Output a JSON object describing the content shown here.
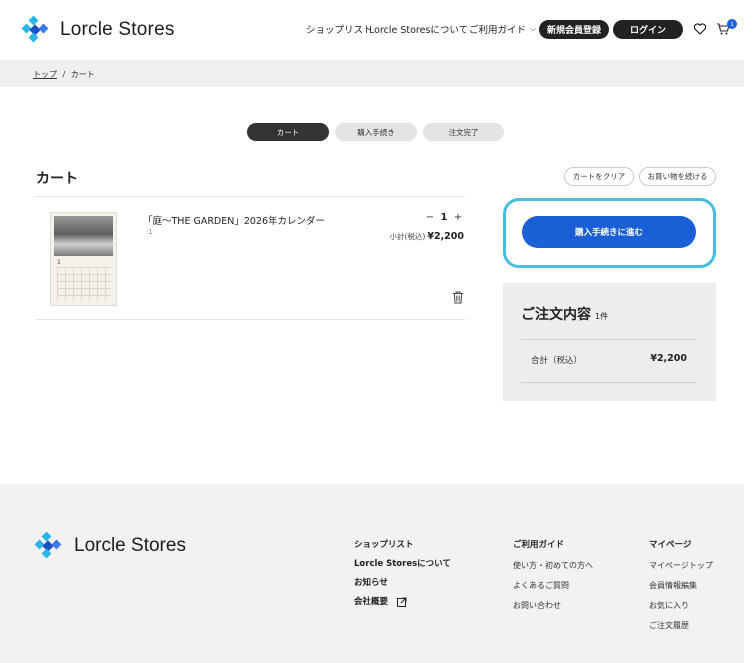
{
  "header": {
    "brand": "Lorcle Stores",
    "nav": [
      "ショップリスト",
      "Lorcle Storesについて",
      "ご利用ガイド"
    ],
    "register_label": "新規会員登録",
    "login_label": "ログイン",
    "cart_count": "1",
    "colors": {
      "brand_blue": "#1a5fd6",
      "logo_cyan": "#2bb4e6",
      "logo_navy": "#1d4fc4"
    }
  },
  "breadcrumb": {
    "home": "トップ",
    "separator": "/",
    "current": "カート"
  },
  "steps": [
    "カート",
    "購入手続き",
    "注文完了"
  ],
  "cart": {
    "title": "カート",
    "clear_label": "カートをクリア",
    "continue_label": "お買い物を続ける",
    "item": {
      "name": "「庭〜THE GARDEN」2026年カレンダー",
      "sub": ":1",
      "month": "1",
      "qty_minus": "−",
      "qty": "1",
      "qty_plus": "+",
      "subtotal_label": "小計(税込)",
      "subtotal_value": "¥2,200"
    }
  },
  "checkout": {
    "label": "購入手続きに進む"
  },
  "summary": {
    "title": "ご注文内容",
    "count": "1件",
    "total_label": "合計（税込）",
    "total_value": "¥2,200"
  },
  "footer": {
    "brand": "Lorcle Stores",
    "col1": [
      "ショップリスト",
      "Lorcle Storesについて",
      "お知らせ",
      "会社概要"
    ],
    "col2_head": "ご利用ガイド",
    "col2": [
      "使い方・初めての方へ",
      "よくあるご質問",
      "お問い合わせ"
    ],
    "col3_head": "マイページ",
    "col3": [
      "マイページトップ",
      "会員情報編集",
      "お気に入り",
      "ご注文履歴"
    ]
  }
}
